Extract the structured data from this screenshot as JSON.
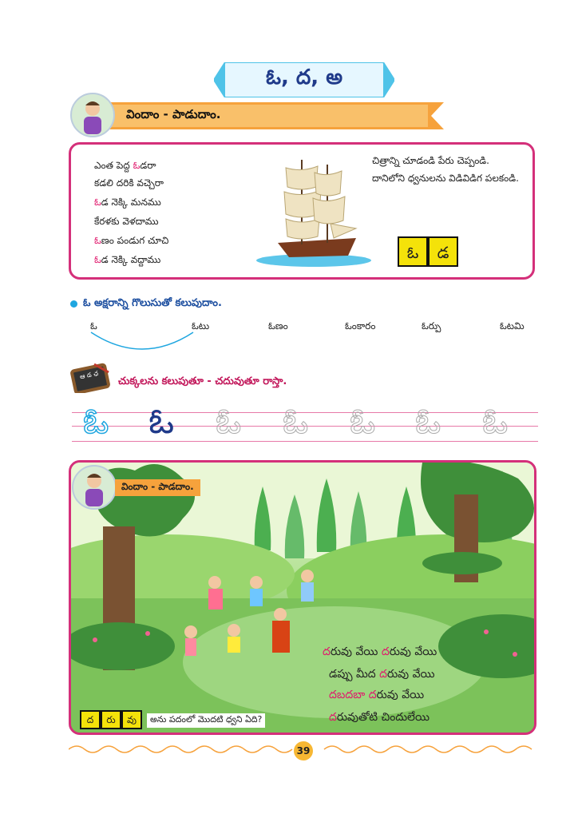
{
  "title": "ఓ, ద, అ",
  "section1": {
    "heading": "విందాం - పాడుదాం."
  },
  "poem": {
    "lines": [
      {
        "a": "ఎంత పెద్ద ",
        "b": "ఓ",
        "c": "డరా"
      },
      {
        "a": "కడలి దరికి వచ్చెరా",
        "b": "",
        "c": ""
      },
      {
        "a": "",
        "b": "ఓ",
        "c": "డ నెక్కి మనము"
      },
      {
        "a": "కేరళకు వెళదాము",
        "b": "",
        "c": ""
      },
      {
        "a": "",
        "b": "ఓ",
        "c": "ణం పండుగ చూచి"
      },
      {
        "a": "",
        "b": "ఓ",
        "c": "డ నెక్కి వద్దాము"
      }
    ],
    "hint1": "చిత్రాన్ని చూడండి పేరు చెప్పండి.",
    "hint2": "దానిలోని ధ్వనులను విడివిడిగ పలకండి.",
    "boxes": [
      "ఓ",
      "డ"
    ]
  },
  "circle_task": {
    "instruction": "ఓ అక్షరాన్ని గొలుసుతో కలుపుదాం.",
    "letter": "ఓ",
    "words": [
      "ఓటు",
      "ఓణం",
      "ఓంకారం",
      "ఓర్పు",
      "ఓటమి"
    ]
  },
  "trace_task": {
    "instruction": "చుక్కలను కలుపుతూ - చదువుతూ రాస్తా.",
    "slate_text": "ఆ డ ఛ",
    "letter": "ఓ"
  },
  "scene": {
    "heading": "విందాం - పాడదాం.",
    "song": [
      [
        {
          "t": "ద",
          "p": true
        },
        {
          "t": "రువు వేయి ",
          "p": false
        },
        {
          "t": "ద",
          "p": true
        },
        {
          "t": "రువు వేయి",
          "p": false
        }
      ],
      [
        {
          "t": "డప్పు మీద ",
          "p": false
        },
        {
          "t": "ద",
          "p": true
        },
        {
          "t": "రువు వేయి",
          "p": false
        }
      ],
      [
        {
          "t": "దబదబా ",
          "p": true
        },
        {
          "t": "ద",
          "p": true
        },
        {
          "t": "రువు వేయి",
          "p": false
        }
      ],
      [
        {
          "t": "ద",
          "p": true
        },
        {
          "t": "రువుతోటి చిందులేయి",
          "p": false
        }
      ]
    ],
    "word_boxes": [
      "ద",
      "రు",
      "వు"
    ],
    "question": "అను పదంలో మొదటి ధ్వని ఏది?"
  },
  "page_number": "39",
  "colors": {
    "accent_pink": "#d4307a",
    "title_blue": "#1f3a8a",
    "ribbon_orange": "#f6a23c",
    "yellow": "#f4e20a"
  }
}
